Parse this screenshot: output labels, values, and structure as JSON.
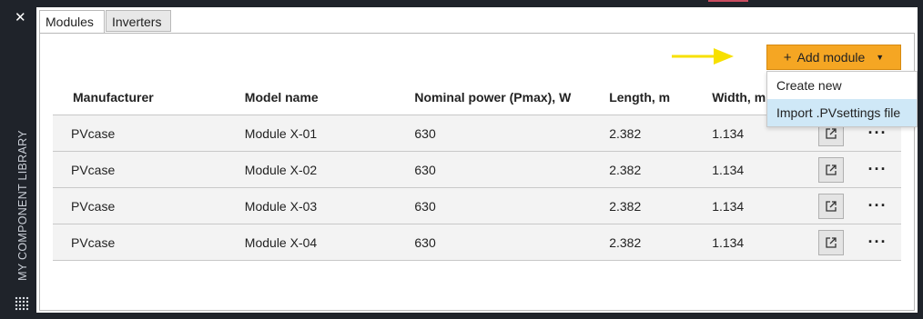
{
  "sidebar": {
    "close_glyph": "✕",
    "title": "MY COMPONENT LIBRARY"
  },
  "tabs": [
    {
      "label": "Modules",
      "active": true
    },
    {
      "label": "Inverters",
      "active": false
    }
  ],
  "toolbar": {
    "add_button_label": "Add module",
    "add_button_icon": "plus-icon",
    "accent_color": "#f5a623",
    "arrow_color": "#f7e000"
  },
  "dropdown": {
    "items": [
      {
        "label": "Create new",
        "highlighted": false
      },
      {
        "label": "Import .PVsettings file",
        "highlighted": true
      }
    ]
  },
  "table": {
    "headers": [
      "Manufacturer",
      "Model name",
      "Nominal power (Pmax), W",
      "Length, m",
      "Width, m"
    ],
    "rows": [
      {
        "manufacturer": "PVcase",
        "model": "Module X-01",
        "power": "630",
        "length": "2.382",
        "width": "1.134"
      },
      {
        "manufacturer": "PVcase",
        "model": "Module X-02",
        "power": "630",
        "length": "2.382",
        "width": "1.134"
      },
      {
        "manufacturer": "PVcase",
        "model": "Module X-03",
        "power": "630",
        "length": "2.382",
        "width": "1.134"
      },
      {
        "manufacturer": "PVcase",
        "model": "Module X-04",
        "power": "630",
        "length": "2.382",
        "width": "1.134"
      }
    ],
    "row_actions": [
      "open-external-icon",
      "more-options-icon"
    ]
  }
}
